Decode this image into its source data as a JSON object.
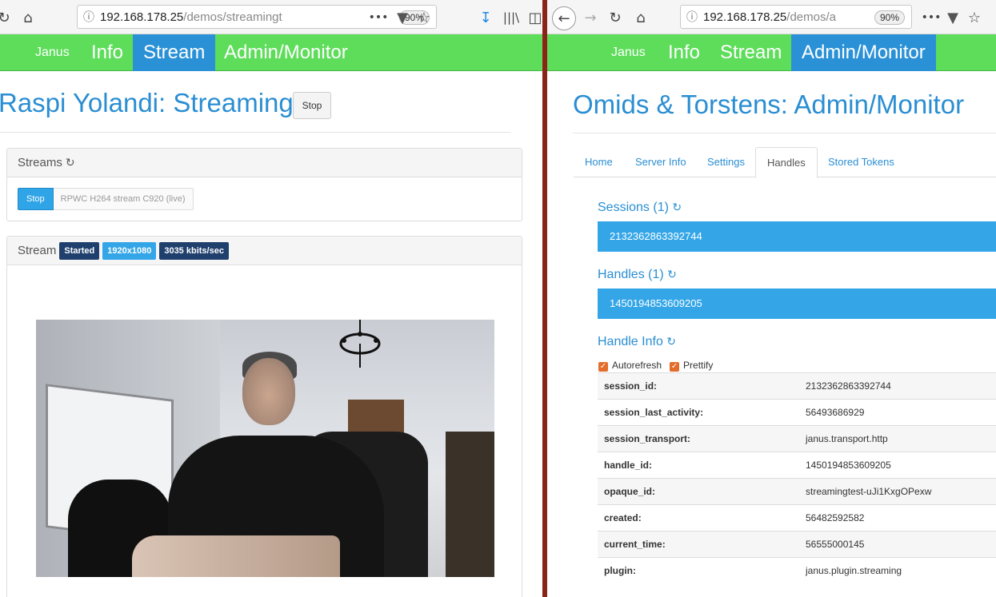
{
  "left": {
    "browser": {
      "url_host": "192.168.178.25",
      "url_path": "/demos/streamingt",
      "zoom": "90%"
    },
    "navbar": {
      "brand": "Janus",
      "items": [
        "Info",
        "Stream",
        "Admin/Monitor"
      ],
      "active": "Stream"
    },
    "page": {
      "title": "Raspi Yolandi: Streaming",
      "stop_button": "Stop"
    },
    "streams_panel": {
      "heading": "Streams",
      "stop_button": "Stop",
      "stream_name": "RPWC H264 stream C920 (live)"
    },
    "stream_panel": {
      "heading": "Stream",
      "status_badge": "Started",
      "resolution_badge": "1920x1080",
      "bitrate_badge": "3035 kbits/sec"
    }
  },
  "right": {
    "browser": {
      "url_host": "192.168.178.25",
      "url_path": "/demos/a",
      "zoom": "90%"
    },
    "navbar": {
      "brand": "Janus",
      "items": [
        "Info",
        "Stream",
        "Admin/Monitor"
      ],
      "active": "Admin/Monitor"
    },
    "page": {
      "title": "Omids & Torstens: Admin/Monitor"
    },
    "tabs": [
      "Home",
      "Server Info",
      "Settings",
      "Handles",
      "Stored Tokens"
    ],
    "active_tab": "Handles",
    "sessions": {
      "title": "Sessions (1)",
      "items": [
        "2132362863392744"
      ]
    },
    "handles": {
      "title": "Handles (1)",
      "items": [
        "1450194853609205"
      ]
    },
    "handle_info": {
      "title": "Handle Info",
      "autorefresh_label": "Autorefresh",
      "prettify_label": "Prettify",
      "rows": [
        {
          "key": "session_id:",
          "value": "2132362863392744"
        },
        {
          "key": "session_last_activity:",
          "value": "56493686929"
        },
        {
          "key": "session_transport:",
          "value": "janus.transport.http"
        },
        {
          "key": "handle_id:",
          "value": "1450194853609205"
        },
        {
          "key": "opaque_id:",
          "value": "streamingtest-uJi1KxgOPexw"
        },
        {
          "key": "created:",
          "value": "56482592582"
        },
        {
          "key": "current_time:",
          "value": "56555000145"
        },
        {
          "key": "plugin:",
          "value": "janus.plugin.streaming"
        }
      ]
    }
  },
  "colors": {
    "navbar_green": "#5ddd5a",
    "active_blue": "#2a91d6",
    "link_blue": "#2a8ed3",
    "list_blue": "#34a6e8",
    "badge_dark": "#1f3f6d",
    "divider": "#8b2418",
    "checkbox_orange": "#e36d2b"
  },
  "icons": {
    "refresh": "refresh-icon",
    "back": "back-arrow-icon",
    "forward": "forward-arrow-icon",
    "reload": "reload-icon",
    "home": "home-icon",
    "info": "info-icon",
    "more": "more-icon",
    "pocket": "pocket-icon",
    "bookmark": "star-icon",
    "download": "download-icon",
    "library": "library-icon",
    "sidebar": "sidebar-icon"
  }
}
